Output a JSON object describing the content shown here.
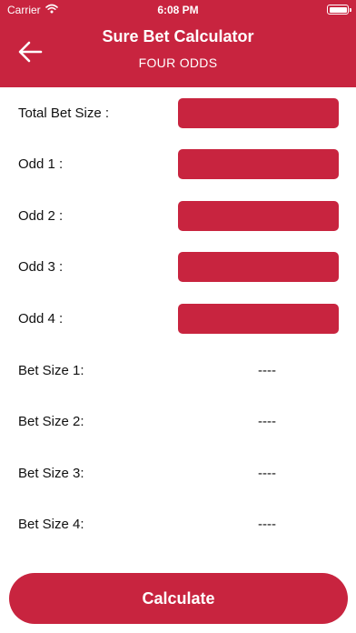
{
  "status_bar": {
    "carrier": "Carrier",
    "time": "6:08 PM"
  },
  "header": {
    "title": "Sure Bet Calculator",
    "subtitle": "FOUR ODDS"
  },
  "inputs": [
    {
      "label": "Total Bet Size :",
      "value": ""
    },
    {
      "label": "Odd 1 :",
      "value": ""
    },
    {
      "label": "Odd 2 :",
      "value": ""
    },
    {
      "label": "Odd 3 :",
      "value": ""
    },
    {
      "label": "Odd 4 :",
      "value": ""
    }
  ],
  "results": [
    {
      "label": "Bet Size 1:",
      "value": "----"
    },
    {
      "label": "Bet Size 2:",
      "value": "----"
    },
    {
      "label": "Bet Size 3:",
      "value": "----"
    },
    {
      "label": "Bet Size 4:",
      "value": "----"
    }
  ],
  "calculate_button": {
    "label": "Calculate"
  },
  "colors": {
    "accent": "#c8243f",
    "background": "#ffffff",
    "text": "#111111"
  }
}
